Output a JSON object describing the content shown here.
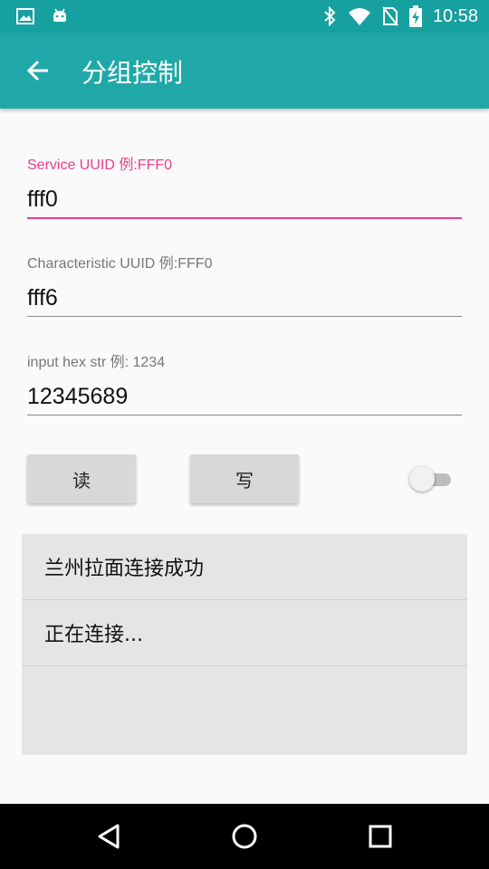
{
  "status_bar": {
    "time": "10:58",
    "icons_left": [
      "image-icon",
      "android-icon"
    ],
    "icons_right": [
      "bluetooth-icon",
      "wifi-icon",
      "no-sim-icon",
      "battery-charging-icon"
    ]
  },
  "app_bar": {
    "title": "分组控制",
    "color": "#20a8a8"
  },
  "form": {
    "service_uuid": {
      "label": "Service UUID 例:FFF0",
      "value": "fff0"
    },
    "characteristic_uuid": {
      "label": "Characteristic UUID 例:FFF0",
      "value": "fff6"
    },
    "hex_input": {
      "label": "input hex str 例: 1234",
      "value": "12345689"
    },
    "accent_color": "#e83e8c"
  },
  "buttons": {
    "read_label": "读",
    "write_label": "写"
  },
  "toggle": {
    "on": false
  },
  "log_list": {
    "items": [
      "兰州拉面连接成功",
      "正在连接..."
    ]
  }
}
